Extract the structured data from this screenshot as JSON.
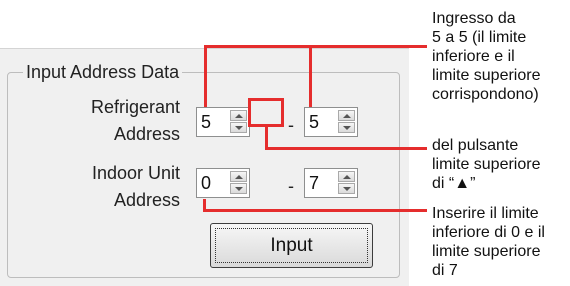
{
  "group_title": "Input Address Data",
  "rows": [
    {
      "label_line1": "Refrigerant",
      "label_line2": "Address",
      "from": "5",
      "to": "5"
    },
    {
      "label_line1": "Indoor Unit",
      "label_line2": "Address",
      "from": "0",
      "to": "7"
    }
  ],
  "separator": "-",
  "button_label": "Input",
  "annotations": {
    "top": [
      "Ingresso da",
      "5 a 5 (il limite",
      "inferiore e il",
      "limite superiore",
      "corrispondono)"
    ],
    "middle": [
      "del pulsante",
      "limite superiore",
      "di “▲”"
    ],
    "bottom": [
      "Inserire il limite",
      "inferiore di 0 e il",
      "limite superiore",
      "di 7"
    ]
  },
  "colors": {
    "annotation": "#e52d2d",
    "panel": "#f0f0f0"
  },
  "icons": {
    "spin_up": "triangle-up-icon",
    "spin_down": "triangle-down-icon"
  }
}
